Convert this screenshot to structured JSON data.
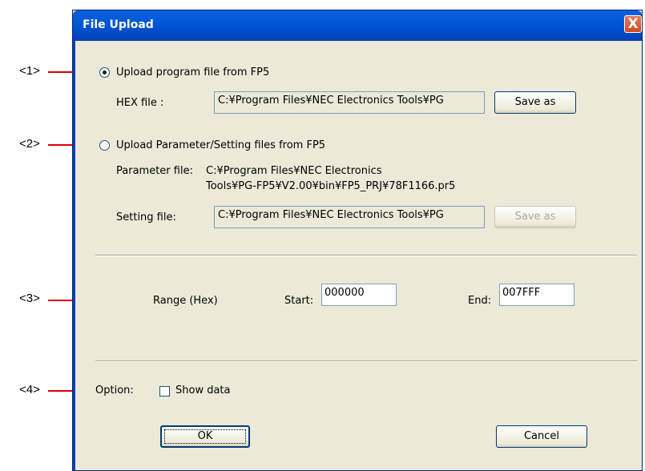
{
  "callouts": [
    "<1>",
    "<2>",
    "<3>",
    "<4>"
  ],
  "dialog": {
    "title": "File Upload",
    "close_label": "X"
  },
  "upload_program": {
    "radio_label": "Upload program file from FP5",
    "checked": true,
    "hex_label": "HEX file :",
    "hex_path": "C:¥Program Files¥NEC Electronics Tools¥PG",
    "save_label": "Save as"
  },
  "upload_param": {
    "radio_label": "Upload Parameter/Setting files from FP5",
    "checked": false,
    "param_label": "Parameter file:",
    "param_path_line1": "C:¥Program Files¥NEC Electronics",
    "param_path_line2": "Tools¥PG-FP5¥V2.00¥bin¥FP5_PRJ¥78F1166.pr5",
    "setting_label": "Setting file:",
    "setting_path": "C:¥Program Files¥NEC Electronics Tools¥PG",
    "save_label": "Save as"
  },
  "range": {
    "label": "Range (Hex)",
    "start_label": "Start:",
    "start_value": "000000",
    "end_label": "End:",
    "end_value": "007FFF"
  },
  "option": {
    "label": "Option:",
    "show_data_label": "Show data",
    "show_data_checked": false
  },
  "buttons": {
    "ok": "OK",
    "cancel": "Cancel"
  },
  "colors": {
    "arrow": "#e00000",
    "titlebar": "#0058d8",
    "dialog_bg": "#ece9d8"
  }
}
